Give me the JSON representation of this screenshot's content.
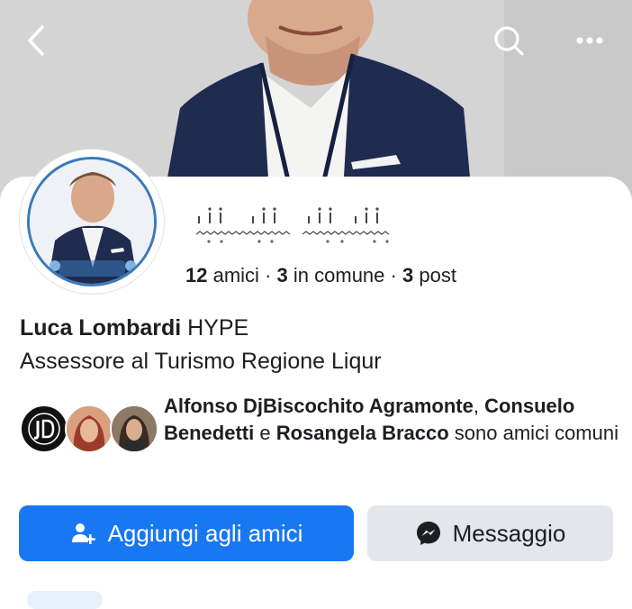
{
  "icons": {
    "back": "back-arrow-icon",
    "search": "search-icon",
    "more": "more-options-icon",
    "add_friend": "add-friend-icon",
    "messenger": "messenger-icon"
  },
  "profile": {
    "name": "Luca Lombardi",
    "name_suffix": "HYPE",
    "bio": "Assessore al Turismo Regione Liqur",
    "stats": {
      "friends_count": "12",
      "friends_label": "amici",
      "mutual_count": "3",
      "mutual_label": "in comune",
      "posts_count": "3",
      "posts_label": "post",
      "separator": " · "
    }
  },
  "mutual": {
    "name1": "Alfonso DjBiscochito Agramonte",
    "comma": ", ",
    "name2": "Consuelo Benedetti",
    "conj": " e ",
    "name3": "Rosangela Bracco",
    "suffix": " sono amici comuni"
  },
  "actions": {
    "add_friend_label": "Aggiungi agli amici",
    "message_label": "Messaggio"
  },
  "colors": {
    "primary": "#1877f2",
    "secondary_bg": "#e4e6eb",
    "text": "#1c1e21"
  }
}
